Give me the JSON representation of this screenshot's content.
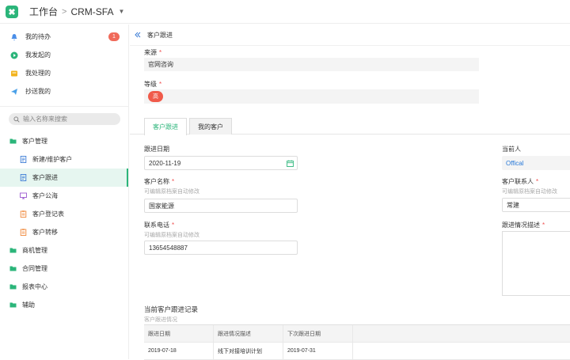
{
  "topbar": {
    "workbench": "工作台",
    "app": "CRM-SFA"
  },
  "sidebar": {
    "todos": [
      {
        "label": "我的待办",
        "badge": "1",
        "icon": "bell-icon",
        "color": "#4a8ee8"
      },
      {
        "label": "我发起的",
        "icon": "play-icon",
        "color": "#2bb57a"
      },
      {
        "label": "我处理的",
        "icon": "inbox-icon",
        "color": "#f2b31e"
      },
      {
        "label": "抄送我的",
        "icon": "send-icon",
        "color": "#4aa0e8"
      }
    ],
    "search_placeholder": "输入名称来搜索",
    "nav": [
      {
        "label": "客户管理",
        "level": 1,
        "icon": "folder-icon"
      },
      {
        "label": "新建/维护客户",
        "level": 2,
        "icon": "document-icon"
      },
      {
        "label": "客户跟进",
        "level": 2,
        "icon": "document-icon",
        "active": true
      },
      {
        "label": "客户公海",
        "level": 2,
        "icon": "monitor-icon"
      },
      {
        "label": "客户登记表",
        "level": 2,
        "icon": "clipboard-icon"
      },
      {
        "label": "客户转移",
        "level": 2,
        "icon": "clipboard-icon"
      },
      {
        "label": "商机管理",
        "level": 1,
        "icon": "folder-icon"
      },
      {
        "label": "合同管理",
        "level": 1,
        "icon": "folder-icon"
      },
      {
        "label": "报表中心",
        "level": 1,
        "icon": "folder-icon"
      },
      {
        "label": "辅助",
        "level": 1,
        "icon": "folder-icon"
      }
    ]
  },
  "page": {
    "title": "客户跟进",
    "source_label": "来源",
    "source_value": "官网咨询",
    "level_label": "等级",
    "level_value": "高",
    "tabs": [
      "客户跟进",
      "我的客户"
    ],
    "follow_date_label": "跟进日期",
    "follow_date_value": "2020-11-19",
    "customer_name_label": "客户名称",
    "customer_name_hint": "可编辑原档案自动修改",
    "customer_name_value": "国家能源",
    "phone_label": "联系电话",
    "phone_hint": "可编辑原档案自动修改",
    "phone_value": "13654548887",
    "current_person_label": "当前人",
    "current_person_value": "Offical",
    "contact_label": "客户联系人",
    "contact_hint": "可编辑原档案自动修改",
    "contact_value": "常建",
    "desc_label": "跟进情况描述",
    "records_title": "当前客户跟进记录",
    "records_subtitle": "客户跟进情况",
    "table": {
      "headers": [
        "跟进日期",
        "跟进情况描述",
        "下次跟进日期",
        ""
      ],
      "rows": [
        [
          "2019-07-18",
          "线下对接培训计划",
          "2019-07-31",
          ""
        ]
      ]
    }
  },
  "colors": {
    "accent": "#2bb57a",
    "badge": "#f06a5a",
    "required": "#f05050"
  }
}
